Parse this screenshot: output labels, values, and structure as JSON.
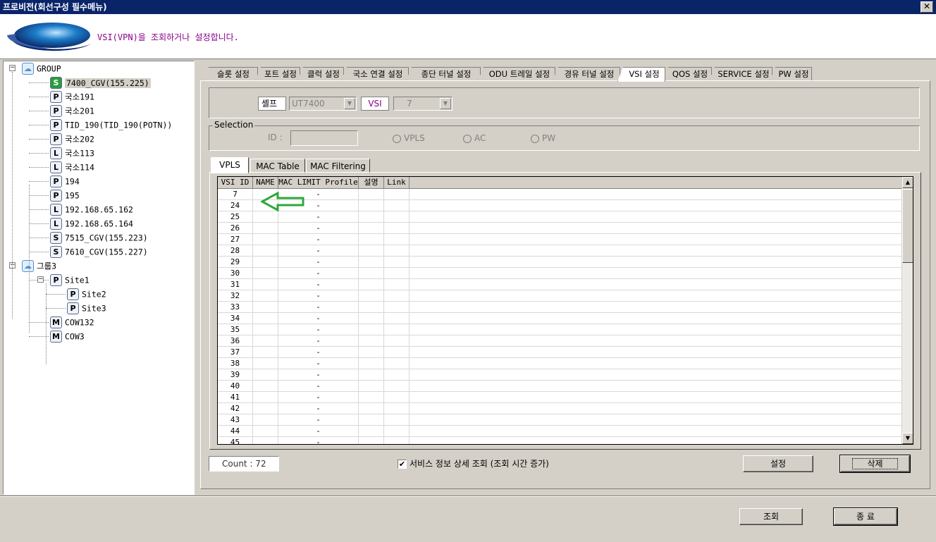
{
  "window": {
    "title": "프로비전(회선구성 필수메뉴)",
    "close_label": "✕"
  },
  "header": {
    "message": "VSI(VPN)을 조회하거나 설정합니다."
  },
  "tree": [
    {
      "label": "GROUP",
      "icon": "cloud",
      "level": 0,
      "expander": "−"
    },
    {
      "label": "7400_CGV(155.225)",
      "icon": "S",
      "level": 1,
      "selected": true
    },
    {
      "label": "국소191",
      "icon": "P",
      "level": 1
    },
    {
      "label": "국소201",
      "icon": "P",
      "level": 1
    },
    {
      "label": "TID_190(TID_190(POTN))",
      "icon": "P",
      "level": 1
    },
    {
      "label": "국소202",
      "icon": "P",
      "level": 1
    },
    {
      "label": "국소113",
      "icon": "L",
      "level": 1
    },
    {
      "label": "국소114",
      "icon": "L",
      "level": 1
    },
    {
      "label": "194",
      "icon": "P",
      "level": 1
    },
    {
      "label": "195",
      "icon": "P",
      "level": 1
    },
    {
      "label": "192.168.65.162",
      "icon": "L",
      "level": 1
    },
    {
      "label": "192.168.65.164",
      "icon": "L",
      "level": 1
    },
    {
      "label": "7515_CGV(155.223)",
      "icon": "S",
      "level": 1
    },
    {
      "label": "7610_CGV(155.227)",
      "icon": "S",
      "level": 1
    },
    {
      "label": "그룹3",
      "icon": "cloud",
      "level": 0,
      "expander": "−"
    },
    {
      "label": "Site1",
      "icon": "P",
      "level": 1,
      "expander": "−"
    },
    {
      "label": "Site2",
      "icon": "P",
      "level": 2
    },
    {
      "label": "Site3",
      "icon": "P",
      "level": 2
    },
    {
      "label": "COW132",
      "icon": "M",
      "level": 1
    },
    {
      "label": "COW3",
      "icon": "M",
      "level": 1
    }
  ],
  "tabs": [
    "슬롯 설정",
    "포트 설정",
    "클럭 설정",
    "국소 연결 설정",
    "종단 터널 설정",
    "ODU 트레일 설정",
    "경유 터널 설정",
    "VSI 설정",
    "QOS 설정",
    "SERVICE 설정",
    "PW 설정"
  ],
  "active_tab": "VSI 설정",
  "selector": {
    "shelf_label": "셸프",
    "shelf_value": "UT7400",
    "vsi_label": "VSI",
    "vsi_value": "7"
  },
  "selection": {
    "legend": "Selection",
    "id_label": "ID :",
    "id_value": "",
    "radios": [
      "VPLS",
      "AC",
      "PW"
    ]
  },
  "inner_tabs": [
    "VPLS",
    "MAC Table",
    "MAC Filtering"
  ],
  "active_inner_tab": "VPLS",
  "grid": {
    "columns": [
      "VSI ID",
      "NAME",
      "MAC LIMIT Profile",
      "설명",
      "Link",
      ""
    ],
    "rows": [
      [
        "7",
        "",
        "-",
        "",
        "",
        ""
      ],
      [
        "24",
        "",
        "-",
        "",
        "",
        ""
      ],
      [
        "25",
        "",
        "-",
        "",
        "",
        ""
      ],
      [
        "26",
        "",
        "-",
        "",
        "",
        ""
      ],
      [
        "27",
        "",
        "-",
        "",
        "",
        ""
      ],
      [
        "28",
        "",
        "-",
        "",
        "",
        ""
      ],
      [
        "29",
        "",
        "-",
        "",
        "",
        ""
      ],
      [
        "30",
        "",
        "-",
        "",
        "",
        ""
      ],
      [
        "31",
        "",
        "-",
        "",
        "",
        ""
      ],
      [
        "32",
        "",
        "-",
        "",
        "",
        ""
      ],
      [
        "33",
        "",
        "-",
        "",
        "",
        ""
      ],
      [
        "34",
        "",
        "-",
        "",
        "",
        ""
      ],
      [
        "35",
        "",
        "-",
        "",
        "",
        ""
      ],
      [
        "36",
        "",
        "-",
        "",
        "",
        ""
      ],
      [
        "37",
        "",
        "-",
        "",
        "",
        ""
      ],
      [
        "38",
        "",
        "-",
        "",
        "",
        ""
      ],
      [
        "39",
        "",
        "-",
        "",
        "",
        ""
      ],
      [
        "40",
        "",
        "-",
        "",
        "",
        ""
      ],
      [
        "41",
        "",
        "-",
        "",
        "",
        ""
      ],
      [
        "42",
        "",
        "-",
        "",
        "",
        ""
      ],
      [
        "43",
        "",
        "-",
        "",
        "",
        ""
      ],
      [
        "44",
        "",
        "-",
        "",
        "",
        ""
      ],
      [
        "45",
        "",
        "-",
        "",
        "",
        ""
      ]
    ]
  },
  "count_text": "Count : 72",
  "detail_checkbox": {
    "label": "서비스 정보 상세 조회 (조회 시간 증가)",
    "checked": true,
    "mark": "✔"
  },
  "buttons": {
    "set": "설정",
    "delete": "삭제",
    "query": "조회",
    "exit": "종 료"
  },
  "scroll": {
    "up": "▲",
    "down": "▼",
    "combo_arrow": "▼"
  },
  "annotation": {
    "arrow_color": "#2ea83a"
  }
}
